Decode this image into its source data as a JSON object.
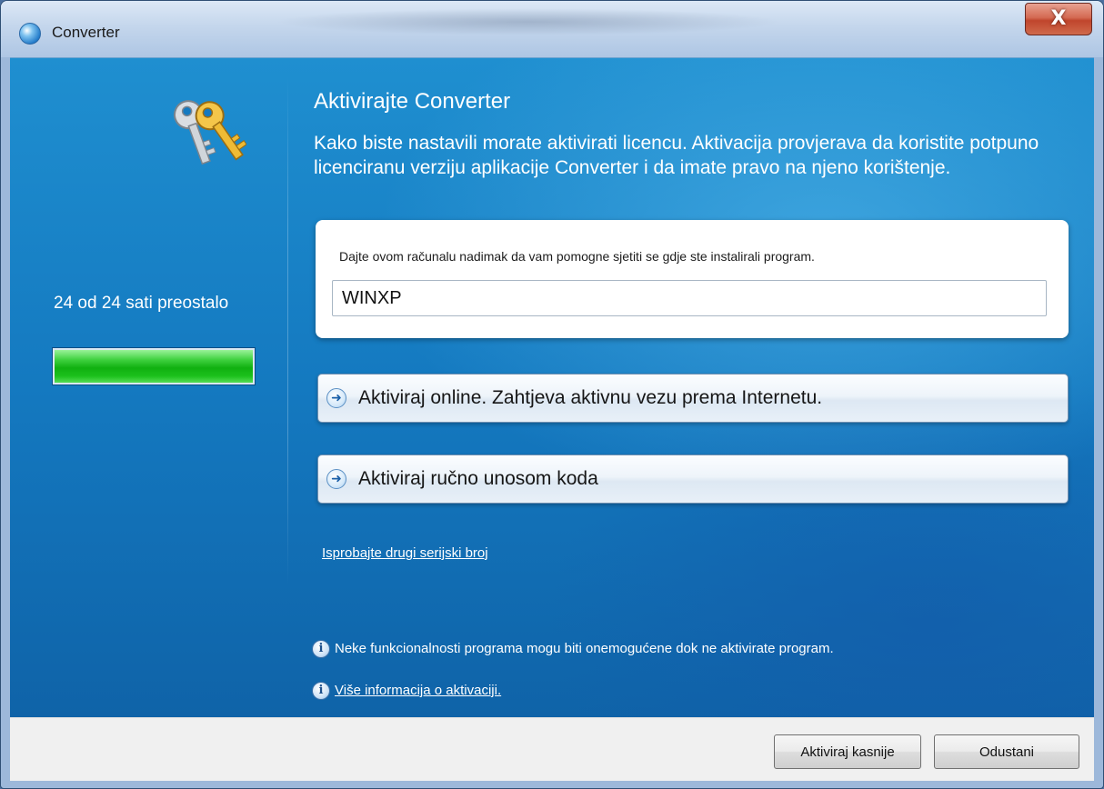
{
  "window": {
    "title": "Converter",
    "close_label": "X"
  },
  "sidebar": {
    "hours_remaining": "24 od 24 sati preostalo",
    "progress_percent": 100,
    "icon": "keys-icon"
  },
  "main": {
    "heading": "Aktivirajte Converter",
    "description": "Kako biste nastavili morate aktivirati licencu. Aktivacija provjerava da koristite potpuno licenciranu verziju aplikacije Converter i da imate pravo na njeno korištenje.",
    "nickname_label": "Dajte ovom računalu nadimak da vam pomogne sjetiti se gdje ste instalirali program.",
    "nickname_value": "WINXP",
    "activate_online_label": "Aktiviraj online. Zahtjeva aktivnu vezu prema Internetu.",
    "activate_manual_label": "Aktiviraj ručno unosom koda",
    "serial_link": "Isprobajte drugi serijski broj",
    "info_text": "Neke funkcionalnosti programa mogu biti onemogućene dok ne aktivirate program.",
    "more_info_link": "Više informacija o aktivaciji."
  },
  "footer": {
    "later_label": "Aktiviraj kasnije",
    "cancel_label": "Odustani"
  },
  "colors": {
    "accent_blue": "#1479c0",
    "progress_green": "#10b010",
    "close_red": "#c0452c"
  }
}
